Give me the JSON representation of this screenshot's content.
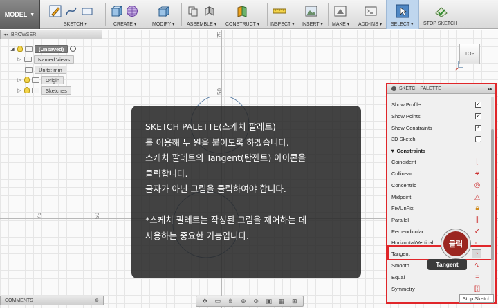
{
  "toolbar": {
    "mode": "MODEL",
    "groups": {
      "sketch": "SKETCH",
      "create": "CREATE",
      "modify": "MODIFY",
      "assemble": "ASSEMBLE",
      "construct": "CONSTRUCT",
      "inspect": "INSPECT",
      "insert": "INSERT",
      "make": "MAKE",
      "addins": "ADD-INS",
      "select": "SELECT",
      "stop_sketch": "STOP SKETCH"
    }
  },
  "browser": {
    "title": "BROWSER",
    "root": "(Unsaved)",
    "items": [
      "Named Views",
      "Units: mm",
      "Origin",
      "Sketches"
    ]
  },
  "comments": {
    "title": "COMMENTS"
  },
  "viewcube": {
    "label": "TOP"
  },
  "rulers": {
    "top_75": "75",
    "top_50": "50",
    "left_75": "75",
    "left_50": "50"
  },
  "palette": {
    "title": "SKETCH PALETTE",
    "options": [
      {
        "label": "Show Profile",
        "checked": true
      },
      {
        "label": "Show Points",
        "checked": true
      },
      {
        "label": "Show Constraints",
        "checked": true
      },
      {
        "label": "3D Sketch",
        "checked": false
      }
    ],
    "section": "Constraints",
    "constraints": [
      "Coincident",
      "Collinear",
      "Concentric",
      "Midpoint",
      "Fix/UnFix",
      "Parallel",
      "Perpendicular",
      "Horizontal/Vertical",
      "Tangent",
      "Smooth",
      "Equal",
      "Symmetry"
    ],
    "stop_button": "Stop Sketch"
  },
  "callouts": {
    "click": "클릭",
    "tooltip": "Tangent"
  },
  "overlay": {
    "lines": [
      "SKETCH PALETTE(스케치 팔레트)",
      "를 이용해 두 원을 붙이도록 하겠습니다.",
      "스케치 팔레트의 Tangent(탄젠트) 아이콘을",
      "클릭합니다.",
      "글자가 아닌 그림을 클릭하여야 합니다."
    ],
    "note_lines": [
      "*스케치 팔레트는 작성된 그림을 제어하는 데",
      "사용하는 중요한 기능입니다."
    ]
  },
  "colors": {
    "highlight_red": "#e0262a",
    "select_blue": "#bfd6ee",
    "overlay_bg": "#282828"
  }
}
